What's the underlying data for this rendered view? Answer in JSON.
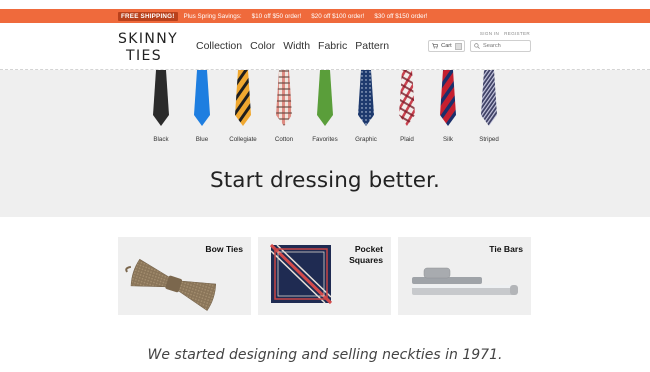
{
  "promo": {
    "badge": "FREE SHIPPING!",
    "lead": "Plus Spring Savings:",
    "offers": [
      "$10 off $50 order!",
      "$20 off $100 order!",
      "$30 off $150 order!"
    ]
  },
  "header": {
    "logo_line1": "SKINNY",
    "logo_line2": "TIES",
    "nav": [
      "Collection",
      "Color",
      "Width",
      "Fabric",
      "Pattern"
    ],
    "sign_in": "SIGN IN",
    "register": "REGISTER",
    "cart_label": "Cart",
    "search_placeholder": "Search"
  },
  "hero": {
    "ties": [
      {
        "label": "Black",
        "color": "#2b2b2b"
      },
      {
        "label": "Blue",
        "color": "#1e7ee0"
      },
      {
        "label": "Collegiate",
        "color": "#f0a830"
      },
      {
        "label": "Cotton",
        "color": "#d9756b"
      },
      {
        "label": "Favorites",
        "color": "#5a9e3a"
      },
      {
        "label": "Graphic",
        "color": "#1e3a6e"
      },
      {
        "label": "Plaid",
        "color": "#c9424f"
      },
      {
        "label": "Silk",
        "color": "#c51f2f"
      },
      {
        "label": "Striped",
        "color": "#5b5f82"
      }
    ],
    "tagline": "Start dressing better."
  },
  "categories": [
    {
      "title_line1": "Bow Ties",
      "title_line2": ""
    },
    {
      "title_line1": "Pocket",
      "title_line2": "Squares"
    },
    {
      "title_line1": "Tie Bars",
      "title_line2": ""
    }
  ],
  "story": "We started designing and selling neckties in 1971."
}
